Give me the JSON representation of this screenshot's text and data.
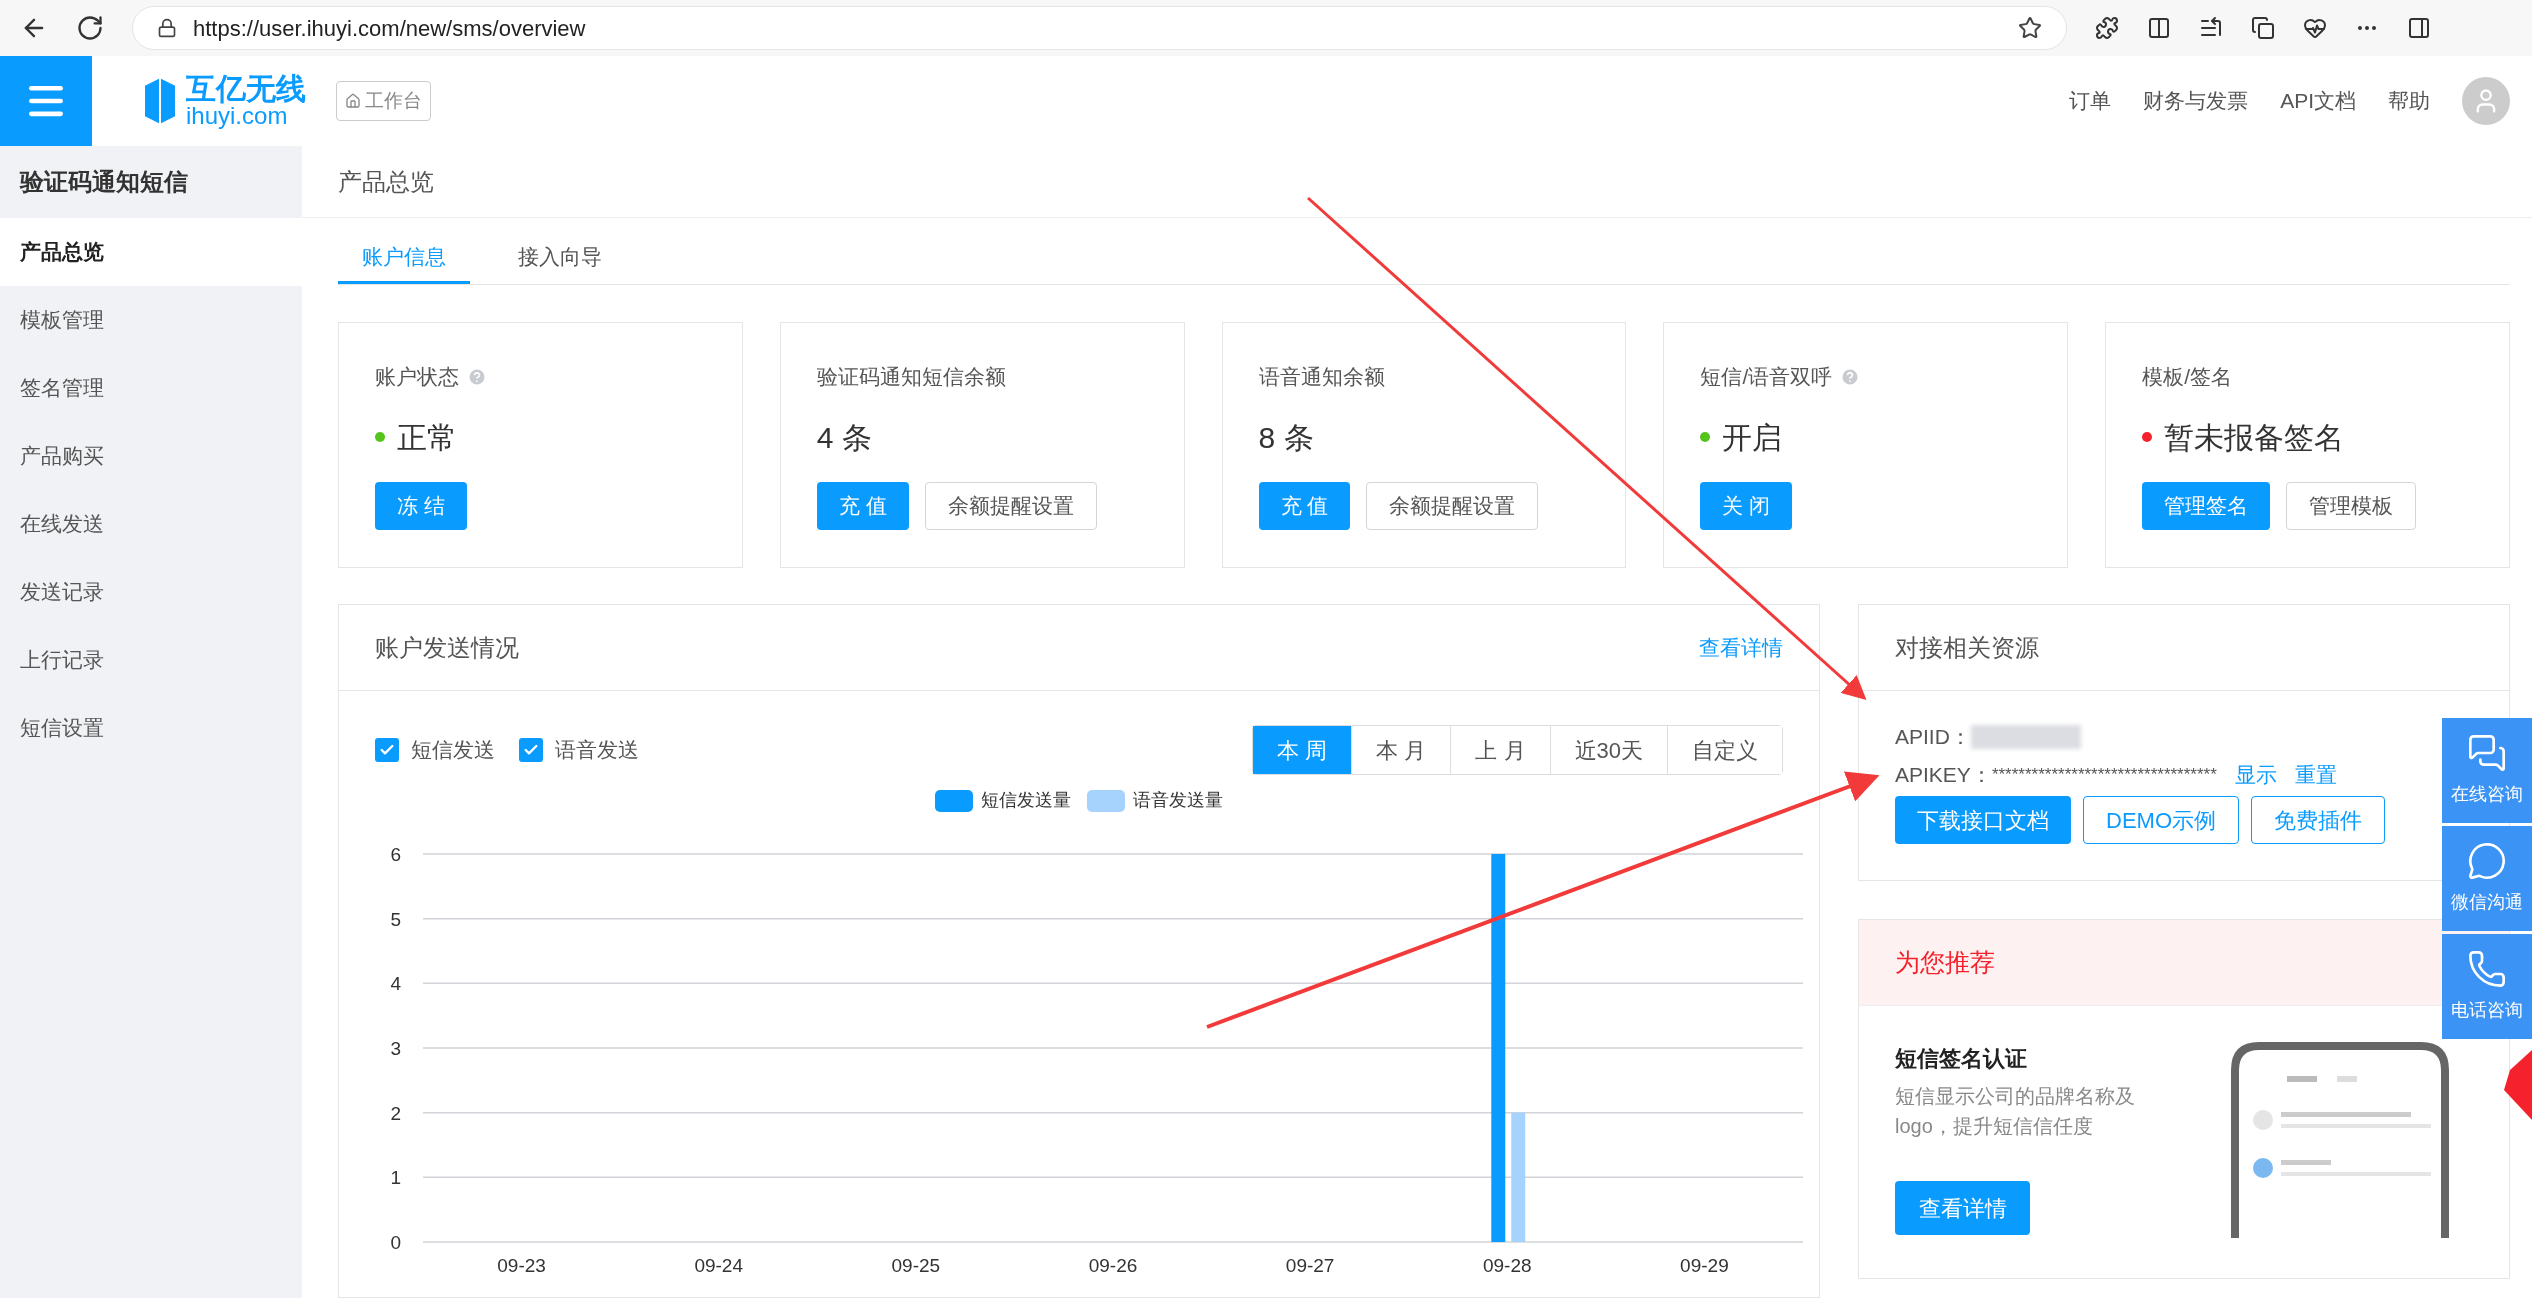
{
  "browser": {
    "url": "https://user.ihuyi.com/new/sms/overview"
  },
  "header": {
    "logo_name": "互亿无线",
    "logo_domain": "ihuyi.com",
    "workbench_button": "工作台",
    "links": [
      "订单",
      "财务与发票",
      "API文档",
      "帮助"
    ]
  },
  "sidebar": {
    "title": "验证码通知短信",
    "items": [
      {
        "label": "产品总览",
        "selected": true
      },
      {
        "label": "模板管理",
        "selected": false
      },
      {
        "label": "签名管理",
        "selected": false
      },
      {
        "label": "产品购买",
        "selected": false
      },
      {
        "label": "在线发送",
        "selected": false
      },
      {
        "label": "发送记录",
        "selected": false
      },
      {
        "label": "上行记录",
        "selected": false
      },
      {
        "label": "短信设置",
        "selected": false
      }
    ]
  },
  "page_title": "产品总览",
  "tabs": [
    {
      "label": "账户信息",
      "selected": true
    },
    {
      "label": "接入向导",
      "selected": false
    }
  ],
  "cards": [
    {
      "title": "账户状态",
      "help": true,
      "value": "正常",
      "color": "#52c41a",
      "buttons": [
        {
          "label": "冻 结",
          "kind": "primary"
        }
      ]
    },
    {
      "title": "验证码通知短信余额",
      "help": false,
      "value": "4 条",
      "buttons": [
        {
          "label": "充 值",
          "kind": "primary"
        },
        {
          "label": "余额提醒设置",
          "kind": "secondary"
        }
      ]
    },
    {
      "title": "语音通知余额",
      "help": false,
      "value": "8 条",
      "buttons": [
        {
          "label": "充 值",
          "kind": "primary"
        },
        {
          "label": "余额提醒设置",
          "kind": "secondary"
        }
      ]
    },
    {
      "title": "短信/语音双呼",
      "help": true,
      "value": "开启",
      "color": "#52c41a",
      "buttons": [
        {
          "label": "关 闭",
          "kind": "primary"
        }
      ]
    },
    {
      "title": "模板/签名",
      "help": false,
      "value": "暂未报备签名",
      "color": "#f5222d",
      "buttons": [
        {
          "label": "管理签名",
          "kind": "primary"
        },
        {
          "label": "管理模板",
          "kind": "secondary"
        }
      ]
    }
  ],
  "send_stats": {
    "title": "账户发送情况",
    "detail_link": "查看详情",
    "filters": [
      {
        "label": "短信发送",
        "checked": true
      },
      {
        "label": "语音发送",
        "checked": true
      }
    ],
    "periods": [
      {
        "label": "本 周",
        "selected": true
      },
      {
        "label": "本 月",
        "selected": false
      },
      {
        "label": "上 月",
        "selected": false
      },
      {
        "label": "近30天",
        "selected": false
      },
      {
        "label": "自定义",
        "selected": false
      }
    ],
    "chart_data": {
      "type": "bar",
      "categories": [
        "09-23",
        "09-24",
        "09-25",
        "09-26",
        "09-27",
        "09-28",
        "09-29"
      ],
      "series": [
        {
          "name": "短信发送量",
          "color": "#0a9bff",
          "values": [
            0,
            0,
            0,
            0,
            0,
            6,
            0
          ]
        },
        {
          "name": "语音发送量",
          "color": "#a6d2fe",
          "values": [
            0,
            0,
            0,
            0,
            0,
            2,
            0
          ]
        }
      ],
      "ylim": [
        0,
        6
      ],
      "grid": true,
      "yticks": [
        0,
        1,
        2,
        3,
        4,
        5,
        6
      ]
    }
  },
  "resources": {
    "title": "对接相关资源",
    "apiid_label": "APIID：",
    "apikey_label": "APIKEY：",
    "apikey_value": "**********************************",
    "key_links": [
      "显示",
      "重置"
    ],
    "buttons": [
      {
        "label": "下载接口文档",
        "kind": "primary"
      },
      {
        "label": "DEMO示例",
        "kind": "outline"
      },
      {
        "label": "免费插件",
        "kind": "outline"
      }
    ]
  },
  "recommend": {
    "title": "为您推荐",
    "item_title": "短信签名认证",
    "description": "短信显示公司的品牌名称及logo，提升短信信任度",
    "button": "查看详情"
  },
  "float_buttons": [
    {
      "label": "在线咨询",
      "kind": "chat"
    },
    {
      "label": "微信沟通",
      "kind": "wechat"
    },
    {
      "label": "电话咨询",
      "kind": "phone"
    }
  ]
}
